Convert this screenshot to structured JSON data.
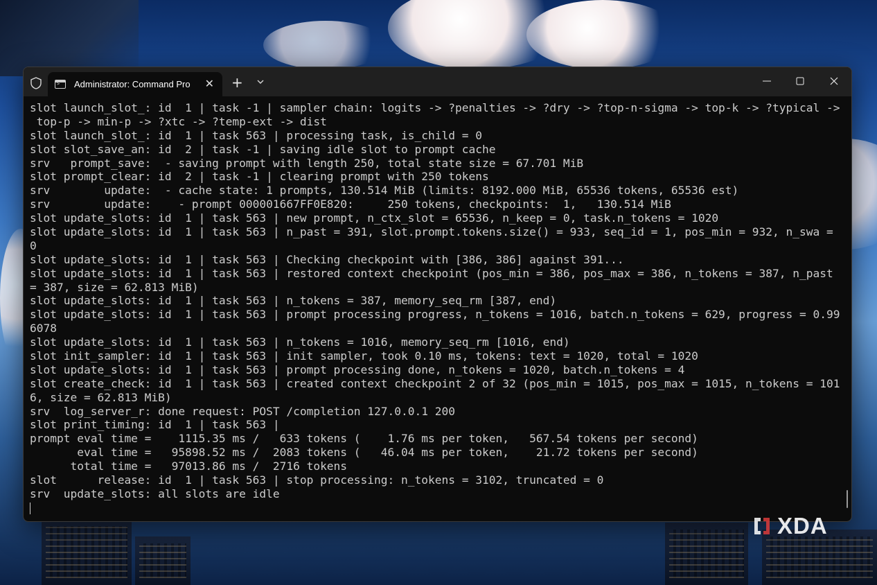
{
  "window": {
    "tab_title": "Administrator: Command Pro",
    "tab_close": "✕",
    "new_tab": "+"
  },
  "terminal": {
    "lines": [
      "slot launch_slot_: id  1 | task -1 | sampler chain: logits -> ?penalties -> ?dry -> ?top-n-sigma -> top-k -> ?typical ->",
      " top-p -> min-p -> ?xtc -> ?temp-ext -> dist",
      "slot launch_slot_: id  1 | task 563 | processing task, is_child = 0",
      "slot slot_save_an: id  2 | task -1 | saving idle slot to prompt cache",
      "srv   prompt_save:  - saving prompt with length 250, total state size = 67.701 MiB",
      "slot prompt_clear: id  2 | task -1 | clearing prompt with 250 tokens",
      "srv        update:  - cache state: 1 prompts, 130.514 MiB (limits: 8192.000 MiB, 65536 tokens, 65536 est)",
      "srv        update:    - prompt 000001667FF0E820:     250 tokens, checkpoints:  1,   130.514 MiB",
      "slot update_slots: id  1 | task 563 | new prompt, n_ctx_slot = 65536, n_keep = 0, task.n_tokens = 1020",
      "slot update_slots: id  1 | task 563 | n_past = 391, slot.prompt.tokens.size() = 933, seq_id = 1, pos_min = 932, n_swa =",
      "0",
      "slot update_slots: id  1 | task 563 | Checking checkpoint with [386, 386] against 391...",
      "slot update_slots: id  1 | task 563 | restored context checkpoint (pos_min = 386, pos_max = 386, n_tokens = 387, n_past",
      "= 387, size = 62.813 MiB)",
      "slot update_slots: id  1 | task 563 | n_tokens = 387, memory_seq_rm [387, end)",
      "slot update_slots: id  1 | task 563 | prompt processing progress, n_tokens = 1016, batch.n_tokens = 629, progress = 0.99",
      "6078",
      "slot update_slots: id  1 | task 563 | n_tokens = 1016, memory_seq_rm [1016, end)",
      "slot init_sampler: id  1 | task 563 | init sampler, took 0.10 ms, tokens: text = 1020, total = 1020",
      "slot update_slots: id  1 | task 563 | prompt processing done, n_tokens = 1020, batch.n_tokens = 4",
      "slot create_check: id  1 | task 563 | created context checkpoint 2 of 32 (pos_min = 1015, pos_max = 1015, n_tokens = 101",
      "6, size = 62.813 MiB)",
      "srv  log_server_r: done request: POST /completion 127.0.0.1 200",
      "slot print_timing: id  1 | task 563 |",
      "prompt eval time =    1115.35 ms /   633 tokens (    1.76 ms per token,   567.54 tokens per second)",
      "       eval time =   95898.52 ms /  2083 tokens (   46.04 ms per token,    21.72 tokens per second)",
      "      total time =   97013.86 ms /  2716 tokens",
      "slot      release: id  1 | task 563 | stop processing: n_tokens = 3102, truncated = 0",
      "srv  update_slots: all slots are idle"
    ]
  },
  "watermark": {
    "text": "XDA"
  },
  "colors": {
    "terminal_bg": "#0c0c0c",
    "titlebar_bg": "#202020",
    "text": "#cccccc"
  }
}
